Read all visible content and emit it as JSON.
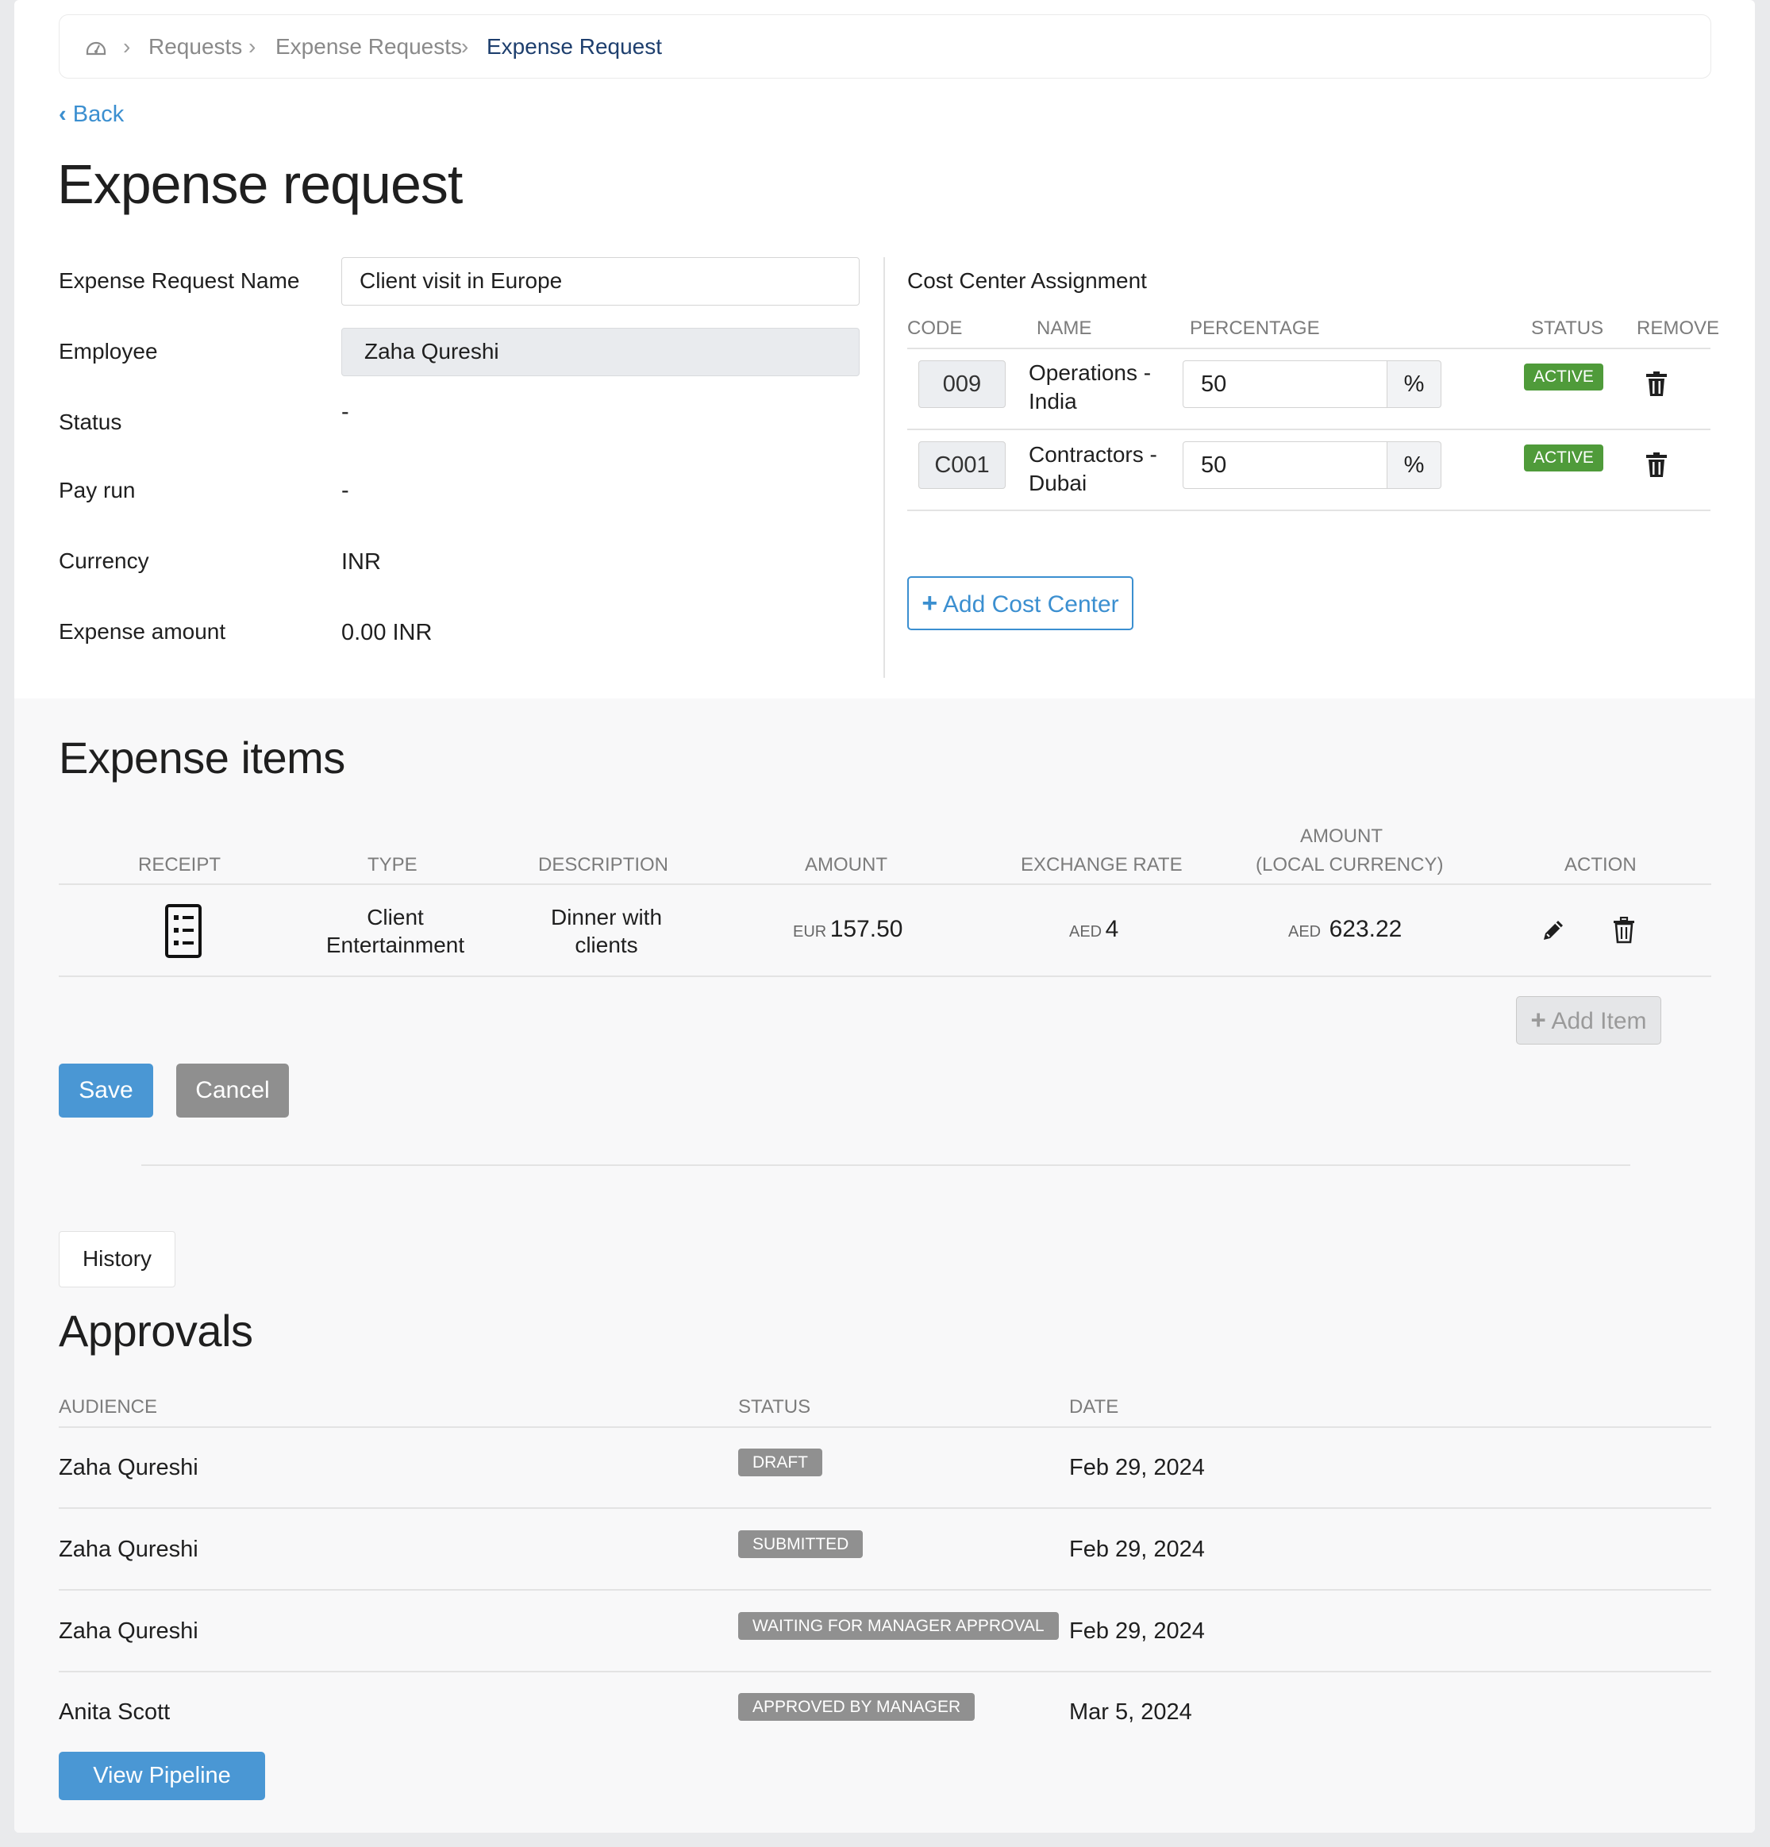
{
  "breadcrumb": {
    "home_icon": "dashboard-gauge-icon",
    "items": [
      "Requests",
      "Expense Requests",
      "Expense Request"
    ]
  },
  "back_label": "Back",
  "page_title": "Expense request",
  "form": {
    "name_label": "Expense Request Name",
    "name_value": "Client visit in Europe",
    "employee_label": "Employee",
    "employee_value": "Zaha Qureshi",
    "status_label": "Status",
    "status_value": "-",
    "payrun_label": "Pay run",
    "payrun_value": "-",
    "currency_label": "Currency",
    "currency_value": "INR",
    "amount_label": "Expense amount",
    "amount_value": "0.00 INR"
  },
  "cost_center": {
    "title": "Cost Center Assignment",
    "headers": {
      "code": "CODE",
      "name": "NAME",
      "percentage": "PERCENTAGE",
      "status": "STATUS",
      "remove": "REMOVE"
    },
    "rows": [
      {
        "code": "009",
        "name_line1": "Operations -",
        "name_line2": "India",
        "percentage": "50",
        "unit": "%",
        "status": "ACTIVE"
      },
      {
        "code": "C001",
        "name_line1": "Contractors -",
        "name_line2": "Dubai",
        "percentage": "50",
        "unit": "%",
        "status": "ACTIVE"
      }
    ],
    "add_label": "Add Cost Center"
  },
  "expense_items": {
    "title": "Expense items",
    "headers": {
      "receipt": "RECEIPT",
      "type": "TYPE",
      "description": "DESCRIPTION",
      "amount": "AMOUNT",
      "exchange_rate": "EXCHANGE RATE",
      "local_amount_line1": "AMOUNT",
      "local_amount_line2": "(LOCAL CURRENCY)",
      "action": "ACTION"
    },
    "rows": [
      {
        "type_line1": "Client",
        "type_line2": "Entertainment",
        "description_line1": "Dinner with",
        "description_line2": "clients",
        "amount_currency": "EUR",
        "amount_value": "157.50",
        "rate_currency": "AED",
        "rate_value": "4",
        "local_currency": "AED",
        "local_value": "623.22"
      }
    ],
    "add_item_label": "Add Item"
  },
  "actions": {
    "save_label": "Save",
    "cancel_label": "Cancel"
  },
  "history_label": "History",
  "approvals": {
    "title": "Approvals",
    "headers": {
      "audience": "AUDIENCE",
      "status": "STATUS",
      "date": "DATE"
    },
    "rows": [
      {
        "audience": "Zaha Qureshi",
        "status": "DRAFT",
        "date": "Feb 29, 2024"
      },
      {
        "audience": "Zaha Qureshi",
        "status": "SUBMITTED",
        "date": "Feb 29, 2024"
      },
      {
        "audience": "Zaha Qureshi",
        "status": "WAITING FOR MANAGER APPROVAL",
        "date": "Feb 29, 2024"
      },
      {
        "audience": "Anita Scott",
        "status": "APPROVED BY MANAGER",
        "date": "Mar 5, 2024"
      }
    ],
    "view_pipeline_label": "View Pipeline"
  },
  "colors": {
    "link": "#3b8fd0",
    "primary_button": "#4a97d4",
    "active_badge": "#4f9b3a",
    "status_badge": "#909090",
    "breadcrumb_active": "#1e3f6e"
  }
}
